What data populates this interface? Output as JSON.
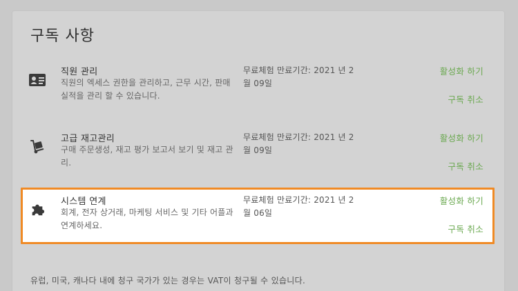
{
  "page": {
    "title": "구독 사항"
  },
  "subscriptions": [
    {
      "icon": "id-card-icon",
      "title": "직원 관리",
      "description": "직원의 엑세스 권한을 관리하고, 근무 시간, 판매실적을 관리 할 수 있습니다.",
      "trial": "무료체험 만료기간: 2021 년 2월 09일",
      "activate_label": "활성화 하기",
      "cancel_label": "구독 취소"
    },
    {
      "icon": "hand-truck-icon",
      "title": "고급 재고관리",
      "description": "구매 주문생성, 재고 평가 보고서 보기 및 재고 관리.",
      "trial": "무료체험 만료기간: 2021 년 2월 09일",
      "activate_label": "활성화 하기",
      "cancel_label": "구독 취소"
    },
    {
      "icon": "puzzle-piece-icon",
      "title": "시스템 연계",
      "description": "회계, 전자 상거래, 마케팅 서비스 및 기타 어플과 연계하세요.",
      "trial": "무료체험 만료기간: 2021 년 2월 06일",
      "activate_label": "활성화 하기",
      "cancel_label": "구독 취소"
    }
  ],
  "footer": {
    "note": "유럽, 미국, 캐나다 내에 청구 국가가 있는 경우는 VAT이 청구될 수 있습니다."
  },
  "colors": {
    "accent": "#6aa84f",
    "highlight_border": "#f08a24",
    "background": "#c9c9c9"
  }
}
